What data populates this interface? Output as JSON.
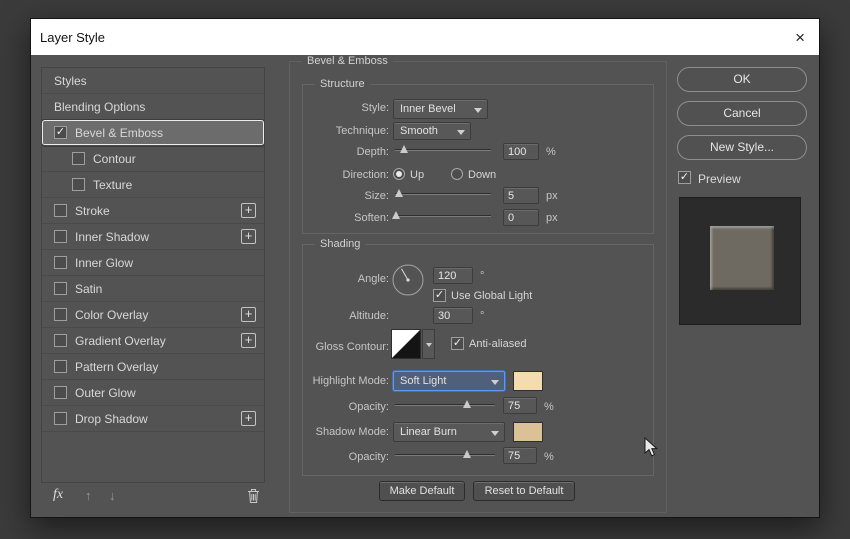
{
  "window": {
    "title": "Layer Style",
    "close_label": "×"
  },
  "icons": {
    "check": "✓",
    "plus": "+"
  },
  "sidebar": {
    "items": [
      {
        "label": "Styles"
      },
      {
        "label": "Blending Options"
      },
      {
        "label": "Bevel & Emboss",
        "checked": true
      },
      {
        "label": "Contour",
        "checked": false
      },
      {
        "label": "Texture",
        "checked": false
      },
      {
        "label": "Stroke",
        "checked": false
      },
      {
        "label": "Inner Shadow",
        "checked": false
      },
      {
        "label": "Inner Glow",
        "checked": false
      },
      {
        "label": "Satin",
        "checked": false
      },
      {
        "label": "Color Overlay",
        "checked": false
      },
      {
        "label": "Gradient Overlay",
        "checked": false
      },
      {
        "label": "Pattern Overlay",
        "checked": false
      },
      {
        "label": "Outer Glow",
        "checked": false
      },
      {
        "label": "Drop Shadow",
        "checked": false
      }
    ],
    "footer": {
      "fx_label": "fx",
      "up_arrow": "↑",
      "down_arrow": "↓"
    }
  },
  "panel": {
    "title": "Bevel & Emboss",
    "structure": {
      "legend": "Structure",
      "style_label": "Style:",
      "style_value": "Inner Bevel",
      "technique_label": "Technique:",
      "technique_value": "Smooth",
      "depth_label": "Depth:",
      "depth_value": "100",
      "depth_unit": "%",
      "direction_label": "Direction:",
      "direction_up": "Up",
      "direction_down": "Down",
      "size_label": "Size:",
      "size_value": "5",
      "size_unit": "px",
      "soften_label": "Soften:",
      "soften_value": "0",
      "soften_unit": "px"
    },
    "shading": {
      "legend": "Shading",
      "angle_label": "Angle:",
      "angle_value": "120",
      "angle_unit": "°",
      "use_global_light_label": "Use Global Light",
      "altitude_label": "Altitude:",
      "altitude_value": "30",
      "altitude_unit": "°",
      "gloss_contour_label": "Gloss Contour:",
      "anti_aliased_label": "Anti-aliased",
      "highlight_mode_label": "Highlight Mode:",
      "highlight_mode_value": "Soft Light",
      "highlight_color": "#f2dcb0",
      "highlight_opacity_label": "Opacity:",
      "highlight_opacity_value": "75",
      "opacity_unit": "%",
      "shadow_mode_label": "Shadow Mode:",
      "shadow_mode_value": "Linear Burn",
      "shadow_color": "#dcc096",
      "shadow_opacity_label": "Opacity:",
      "shadow_opacity_value": "75"
    },
    "buttons": {
      "make_default": "Make Default",
      "reset_to_default": "Reset to Default"
    }
  },
  "actions": {
    "ok": "OK",
    "cancel": "Cancel",
    "new_style": "New Style...",
    "preview_label": "Preview"
  }
}
